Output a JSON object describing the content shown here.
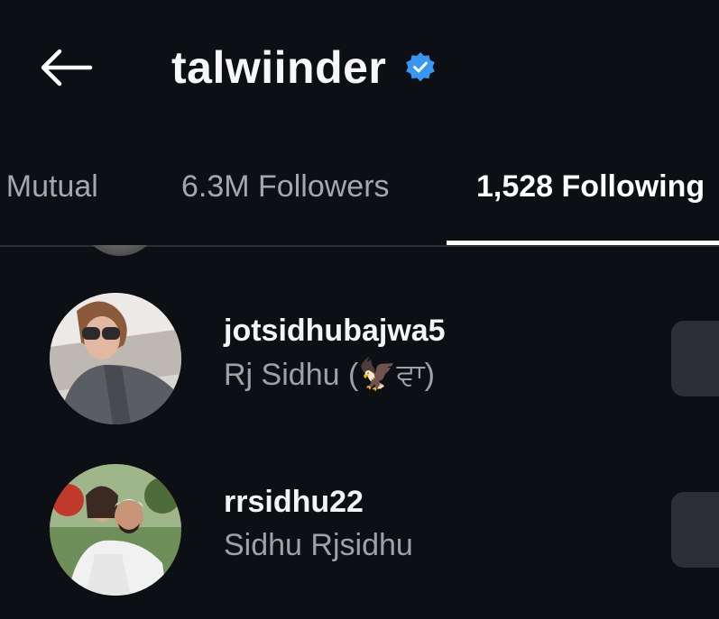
{
  "header": {
    "back_icon": "arrow-left-icon",
    "title": "talwiinder",
    "verified_icon": "verified-badge-icon",
    "verified_color": "#3897f0"
  },
  "tabs": [
    {
      "label": "- Mutual",
      "active": false
    },
    {
      "label": "6.3M Followers",
      "active": false
    },
    {
      "label": "1,528 Following",
      "active": true
    }
  ],
  "following": [
    {
      "username": "jotsidhubajwa5",
      "full_name": "Rj Sidhu (🦅ਵਾ)",
      "avatar_icon": "profile-photo"
    },
    {
      "username": "rrsidhu22",
      "full_name": "Sidhu Rjsidhu",
      "avatar_icon": "profile-photo"
    }
  ],
  "colors": {
    "background": "#0c0f14",
    "text_primary": "#f4f4f4",
    "text_secondary": "#9da2aa",
    "button_bg": "#2c2f35",
    "indicator": "#ffffff"
  }
}
